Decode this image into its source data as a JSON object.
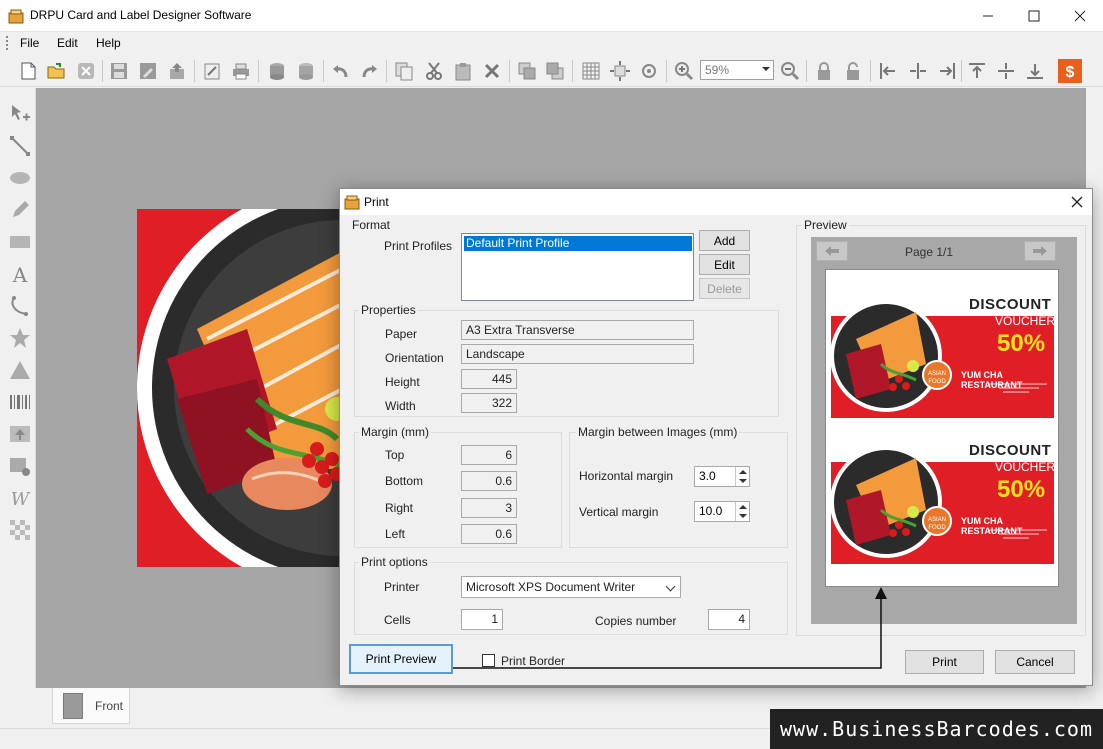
{
  "app": {
    "title": "DRPU Card and Label Designer Software",
    "menu": [
      "File",
      "Edit",
      "Help"
    ],
    "zoom": "59%"
  },
  "toolbar_icons": [
    "new-icon",
    "open-icon",
    "close-icon",
    "save-icon",
    "save-as-icon",
    "export-icon",
    "properties-icon",
    "print-icon",
    "database-icon",
    "database-import-icon",
    "undo-icon",
    "redo-icon",
    "copy-icon",
    "cut-icon",
    "paste-icon",
    "delete-icon",
    "bring-front-icon",
    "send-back-icon",
    "grid-icon",
    "fit-icon",
    "target-icon",
    "zoom-in-icon",
    "zoom-out-icon",
    "lock-icon",
    "unlock-icon",
    "align-left-icon",
    "align-center-icon",
    "align-right-icon",
    "align-top-icon",
    "align-middle-icon",
    "align-bottom-icon",
    "price-icon"
  ],
  "left_tools": [
    "select-icon",
    "line-icon",
    "ellipse-icon",
    "pencil-icon",
    "rectangle-icon",
    "text-icon",
    "arc-icon",
    "star-icon",
    "triangle-icon",
    "barcode-icon",
    "image-icon",
    "image-library-icon",
    "watermark-icon",
    "background-icon"
  ],
  "tabs": {
    "front": "Front"
  },
  "watermark": "www.BusinessBarcodes.com",
  "dialog": {
    "title": "Print",
    "format": {
      "group_label": "Format",
      "profiles_label": "Print Profiles",
      "profiles": [
        "Default Print Profile"
      ],
      "add": "Add",
      "edit": "Edit",
      "delete": "Delete"
    },
    "properties": {
      "group_label": "Properties",
      "paper_label": "Paper",
      "paper": "A3 Extra Transverse",
      "orientation_label": "Orientation",
      "orientation": "Landscape",
      "height_label": "Height",
      "height": "445",
      "width_label": "Width",
      "width": "322"
    },
    "margin": {
      "group_label": "Margin (mm)",
      "top_label": "Top",
      "top": "6",
      "bottom_label": "Bottom",
      "bottom": "0.6",
      "right_label": "Right",
      "right": "3",
      "left_label": "Left",
      "left": "0.6"
    },
    "margin_images": {
      "group_label": "Margin between Images (mm)",
      "horizontal_label": "Horizontal margin",
      "horizontal": "3.0",
      "vertical_label": "Vertical margin",
      "vertical": "10.0"
    },
    "print_options": {
      "group_label": "Print options",
      "printer_label": "Printer",
      "printer": "Microsoft XPS Document Writer",
      "cells_label": "Cells",
      "cells": "1",
      "copies_label": "Copies number",
      "copies": "4"
    },
    "print_preview": "Print Preview",
    "print_border": "Print Border",
    "print_border_checked": false,
    "print": "Print",
    "cancel": "Cancel",
    "preview": {
      "group_label": "Preview",
      "page": "Page 1/1",
      "voucher": {
        "line1": "DISCOUNT",
        "line2": "VOUCHER",
        "percent": "50%",
        "restaurant": "YUM CHA RESTAURANT",
        "badge": "ASIAN FOOD"
      }
    }
  },
  "colors": {
    "accent_red": "#e01e26",
    "selection": "#0078d7",
    "yellow": "#ffe21a"
  }
}
